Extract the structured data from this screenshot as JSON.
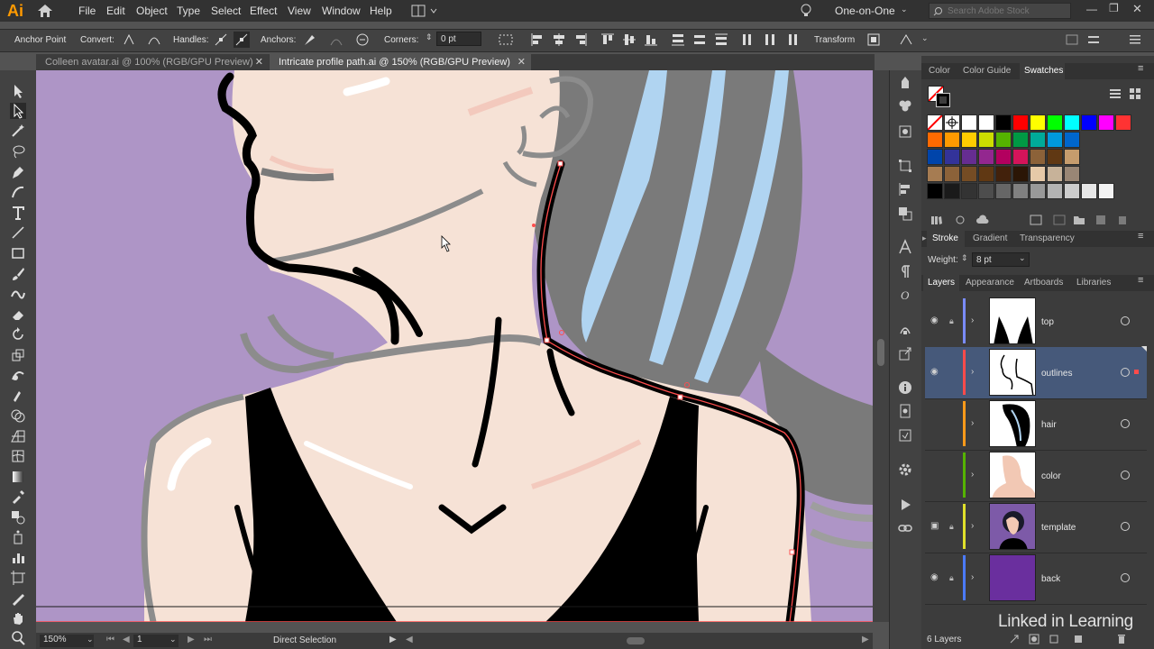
{
  "app": {
    "logo": "Ai"
  },
  "menu": {
    "items": [
      "File",
      "Edit",
      "Object",
      "Type",
      "Select",
      "Effect",
      "View",
      "Window",
      "Help"
    ]
  },
  "workspace": {
    "name": "One-on-One",
    "search_placeholder": "Search Adobe Stock"
  },
  "controlbar": {
    "selection_label": "Anchor Point",
    "convert_label": "Convert:",
    "handles_label": "Handles:",
    "anchors_label": "Anchors:",
    "corners_label": "Corners:",
    "corners_value": "0 pt",
    "transform_label": "Transform"
  },
  "tabs": [
    {
      "label": "Colleen avatar.ai @ 100% (RGB/GPU Preview)",
      "active": false
    },
    {
      "label": "Intricate profile path.ai @ 150% (RGB/GPU Preview)",
      "active": true
    }
  ],
  "status": {
    "zoom": "150%",
    "artboard": "1",
    "tool": "Direct Selection"
  },
  "panels": {
    "color_tabs": [
      "Color",
      "Color Guide",
      "Swatches"
    ],
    "active_color_tab": "Swatches",
    "stroke_tabs": [
      "Stroke",
      "Gradient",
      "Transparency"
    ],
    "stroke_weight_label": "Weight:",
    "stroke_weight_value": "8 pt",
    "layer_tabs": [
      "Layers",
      "Appearance",
      "Artboards",
      "Libraries"
    ],
    "layers": [
      {
        "name": "top",
        "color": "#7a8cff",
        "visible": true,
        "locked": true,
        "selected": false
      },
      {
        "name": "outlines",
        "color": "#ff4b4b",
        "visible": true,
        "locked": false,
        "selected": true
      },
      {
        "name": "hair",
        "color": "#ff9a1a",
        "visible": false,
        "locked": false,
        "selected": false
      },
      {
        "name": "color",
        "color": "#55b300",
        "visible": false,
        "locked": false,
        "selected": false
      },
      {
        "name": "template",
        "color": "#e0e02b",
        "visible": true,
        "locked": true,
        "selected": false
      },
      {
        "name": "back",
        "color": "#4b7bff",
        "visible": true,
        "locked": true,
        "selected": false
      }
    ],
    "layers_count": "6 Layers"
  },
  "watermark": "Linked in Learning",
  "swatches": [
    [
      "#ffffff",
      "#000000",
      "#ff0000",
      "#ffff00",
      "#00ff00",
      "#00ffff",
      "#0000ff",
      "#ff00ff",
      "#ff3333"
    ],
    [
      "#ff6a00",
      "#ff9a00",
      "#ffcc00",
      "#ccdd00",
      "#55b300",
      "#009944",
      "#00aa99",
      "#0099dd",
      "#0066cc"
    ],
    [
      "#0044aa",
      "#333399",
      "#662d91",
      "#93278f",
      "#b3005f",
      "#d4145a",
      "#8c6239",
      "#603813",
      "#c69c6d"
    ],
    [
      "#a67c52",
      "#8c6239",
      "#754c24",
      "#603813",
      "#42210b",
      "#2b1606",
      "#e6c9a8",
      "#c7b299",
      "#998675"
    ],
    [
      "#000000",
      "#1a1a1a",
      "#333333",
      "#4d4d4d",
      "#666666",
      "#808080",
      "#999999",
      "#b3b3b3",
      "#cccccc",
      "#e6e6e6",
      "#f2f2f2"
    ]
  ],
  "colors": {
    "canvas_bg": "#ae95c6",
    "skin": "#f6e2d6",
    "hair_gray": "#7a7a7a",
    "hair_blue": "#b0d4f1",
    "path_red": "#ff4d4d"
  }
}
